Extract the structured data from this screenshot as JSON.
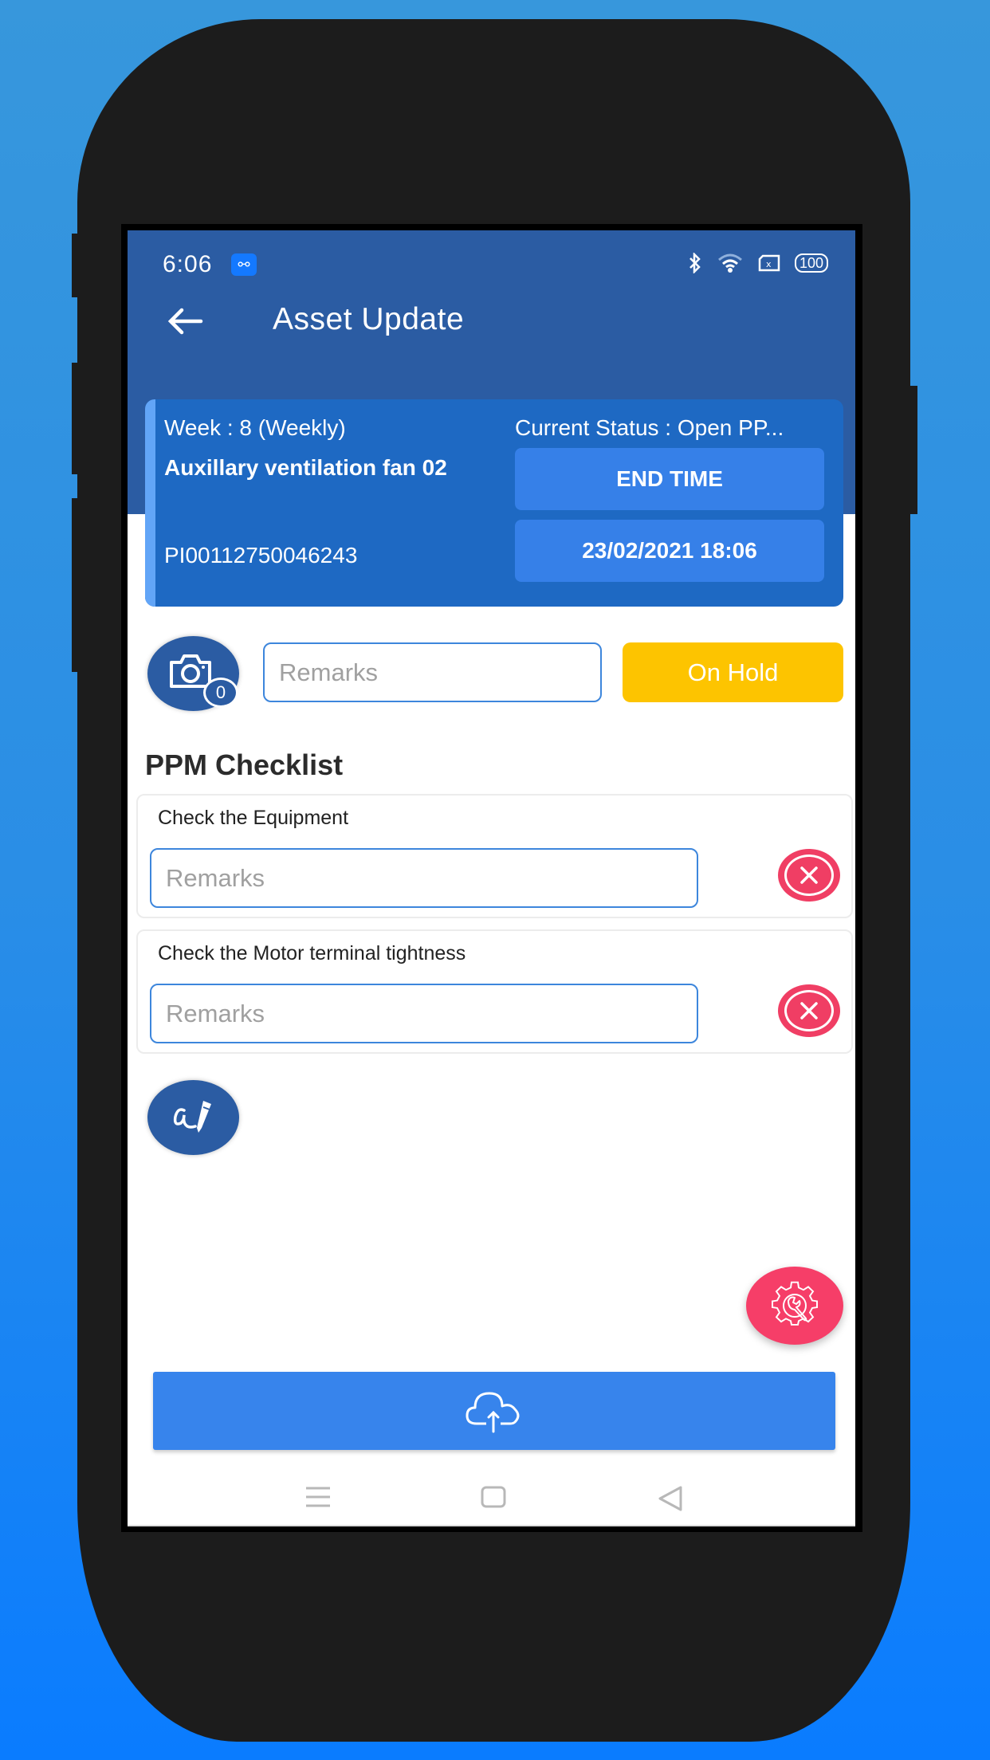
{
  "status_bar": {
    "time": "6:06",
    "usb_icon": "usb-icon",
    "icons": [
      "bluetooth-icon",
      "wifi-icon",
      "sim-icon"
    ],
    "battery": "100"
  },
  "header": {
    "title": "Asset Update",
    "back_icon": "arrow-left-icon"
  },
  "asset": {
    "week": "Week : 8 (Weekly)",
    "name": "Auxillary ventilation fan 02",
    "id": "PI00112750046243",
    "current_status": "Current Status : Open PP...",
    "end_time_label": "END TIME",
    "end_time_value": "23/02/2021 18:06"
  },
  "actions": {
    "photo_count": "0",
    "remarks_placeholder": "Remarks",
    "on_hold_label": "On Hold"
  },
  "checklist": {
    "title": "PPM Checklist",
    "items": [
      {
        "label": "Check the Equipment",
        "remarks_placeholder": "Remarks"
      },
      {
        "label": "Check the Motor terminal tightness",
        "remarks_placeholder": "Remarks"
      }
    ]
  },
  "colors": {
    "header": "#2b5ca3",
    "card": "#1e69c3",
    "card_button": "#3680e8",
    "on_hold": "#fdc400",
    "danger": "#f03e64",
    "upload": "#3784ec"
  }
}
